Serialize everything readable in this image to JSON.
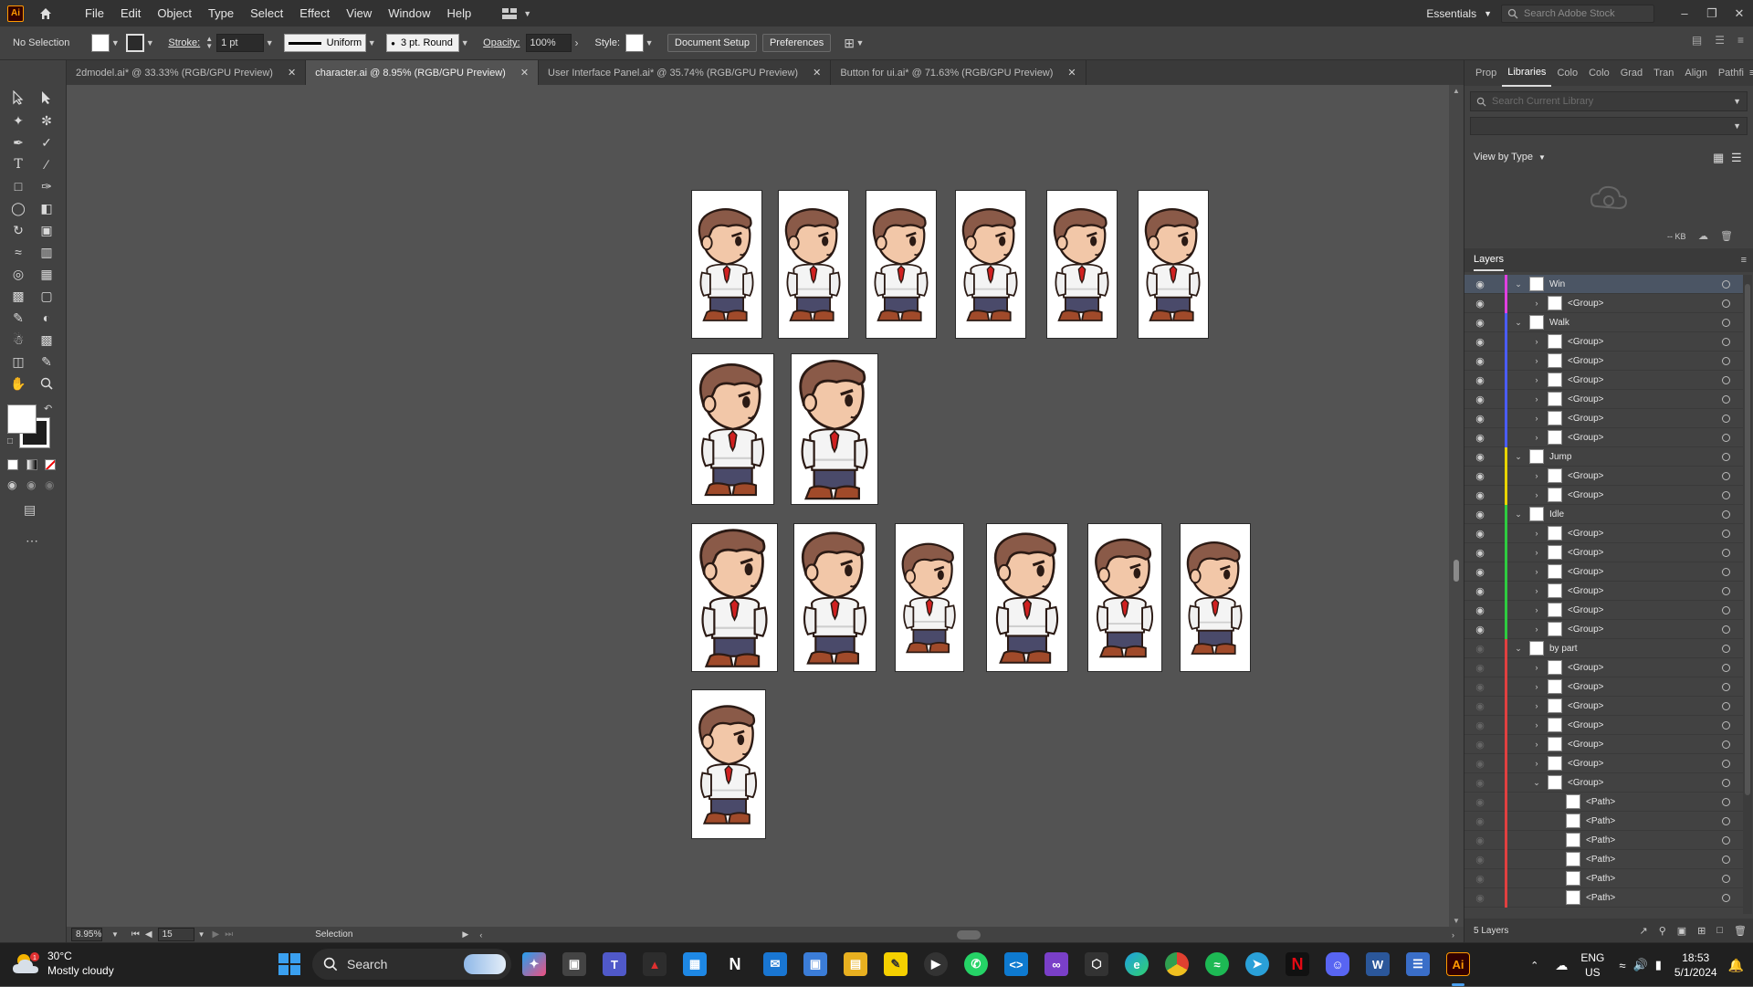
{
  "app": {
    "logo": "Ai"
  },
  "menu": [
    "File",
    "Edit",
    "Object",
    "Type",
    "Select",
    "Effect",
    "View",
    "Window",
    "Help"
  ],
  "workspace": "Essentials",
  "stock_search_placeholder": "Search Adobe Stock",
  "control_bar": {
    "selection": "No Selection",
    "stroke_label": "Stroke:",
    "stroke_weight": "1 pt",
    "stroke_profile": "Uniform",
    "brush": "3 pt. Round",
    "opacity_label": "Opacity:",
    "opacity_value": "100%",
    "style_label": "Style:",
    "document_setup": "Document Setup",
    "preferences": "Preferences"
  },
  "tabs": [
    {
      "label": "2dmodel.ai* @ 33.33% (RGB/GPU Preview)"
    },
    {
      "label": "character.ai @ 8.95% (RGB/GPU Preview)"
    },
    {
      "label": "User Interface Panel.ai* @ 35.74% (RGB/GPU Preview)"
    },
    {
      "label": "Button for ui.ai* @ 71.63% (RGB/GPU Preview)"
    }
  ],
  "status_bar": {
    "zoom": "8.95%",
    "artboard": "15",
    "tool": "Selection"
  },
  "right_panel": {
    "tabs": [
      "Prop",
      "Libraries",
      "Colo",
      "Colo",
      "Grad",
      "Tran",
      "Align",
      "Pathfi"
    ],
    "lib_search_placeholder": "Search Current Library",
    "view_by": "View by Type",
    "kb": "-- KB",
    "layers_tab": "Layers",
    "layers_count": "5 Layers",
    "rows": [
      {
        "name": "Win",
        "color": "#e040e0",
        "eye": true,
        "open": true,
        "indent": 0,
        "twisty": "v"
      },
      {
        "name": "<Group>",
        "color": "#e040e0",
        "eye": true,
        "indent": 1,
        "twisty": ">"
      },
      {
        "name": "Walk",
        "color": "#4a5cff",
        "eye": true,
        "indent": 0,
        "twisty": "v"
      },
      {
        "name": "<Group>",
        "color": "#4a5cff",
        "eye": true,
        "indent": 1,
        "twisty": ">"
      },
      {
        "name": "<Group>",
        "color": "#4a5cff",
        "eye": true,
        "indent": 1,
        "twisty": ">"
      },
      {
        "name": "<Group>",
        "color": "#4a5cff",
        "eye": true,
        "indent": 1,
        "twisty": ">"
      },
      {
        "name": "<Group>",
        "color": "#4a5cff",
        "eye": true,
        "indent": 1,
        "twisty": ">"
      },
      {
        "name": "<Group>",
        "color": "#4a5cff",
        "eye": true,
        "indent": 1,
        "twisty": ">"
      },
      {
        "name": "<Group>",
        "color": "#4a5cff",
        "eye": true,
        "indent": 1,
        "twisty": ">"
      },
      {
        "name": "Jump",
        "color": "#e8d400",
        "eye": true,
        "indent": 0,
        "twisty": "v"
      },
      {
        "name": "<Group>",
        "color": "#e8d400",
        "eye": true,
        "indent": 1,
        "twisty": ">"
      },
      {
        "name": "<Group>",
        "color": "#e8d400",
        "eye": true,
        "indent": 1,
        "twisty": ">"
      },
      {
        "name": "Idle",
        "color": "#2ecc40",
        "eye": true,
        "indent": 0,
        "twisty": "v"
      },
      {
        "name": "<Group>",
        "color": "#2ecc40",
        "eye": true,
        "indent": 1,
        "twisty": ">"
      },
      {
        "name": "<Group>",
        "color": "#2ecc40",
        "eye": true,
        "indent": 1,
        "twisty": ">"
      },
      {
        "name": "<Group>",
        "color": "#2ecc40",
        "eye": true,
        "indent": 1,
        "twisty": ">"
      },
      {
        "name": "<Group>",
        "color": "#2ecc40",
        "eye": true,
        "indent": 1,
        "twisty": ">"
      },
      {
        "name": "<Group>",
        "color": "#2ecc40",
        "eye": true,
        "indent": 1,
        "twisty": ">"
      },
      {
        "name": "<Group>",
        "color": "#2ecc40",
        "eye": true,
        "indent": 1,
        "twisty": ">"
      },
      {
        "name": "by part",
        "color": "#e04040",
        "eye": false,
        "indent": 0,
        "twisty": "v"
      },
      {
        "name": "<Group>",
        "color": "#e04040",
        "eye": false,
        "indent": 1,
        "twisty": ">"
      },
      {
        "name": "<Group>",
        "color": "#e04040",
        "eye": false,
        "indent": 1,
        "twisty": ">"
      },
      {
        "name": "<Group>",
        "color": "#e04040",
        "eye": false,
        "indent": 1,
        "twisty": ">"
      },
      {
        "name": "<Group>",
        "color": "#e04040",
        "eye": false,
        "indent": 1,
        "twisty": ">"
      },
      {
        "name": "<Group>",
        "color": "#e04040",
        "eye": false,
        "indent": 1,
        "twisty": ">"
      },
      {
        "name": "<Group>",
        "color": "#e04040",
        "eye": false,
        "indent": 1,
        "twisty": ">"
      },
      {
        "name": "<Group>",
        "color": "#e04040",
        "eye": false,
        "indent": 1,
        "twisty": "v"
      },
      {
        "name": "<Path>",
        "color": "#e04040",
        "eye": false,
        "indent": 2,
        "twisty": ""
      },
      {
        "name": "<Path>",
        "color": "#e04040",
        "eye": false,
        "indent": 2,
        "twisty": ""
      },
      {
        "name": "<Path>",
        "color": "#e04040",
        "eye": false,
        "indent": 2,
        "twisty": ""
      },
      {
        "name": "<Path>",
        "color": "#e04040",
        "eye": false,
        "indent": 2,
        "twisty": ""
      },
      {
        "name": "<Path>",
        "color": "#e04040",
        "eye": false,
        "indent": 2,
        "twisty": ""
      },
      {
        "name": "<Path>",
        "color": "#e04040",
        "eye": false,
        "indent": 2,
        "twisty": ""
      }
    ]
  },
  "taskbar": {
    "temperature": "30°C",
    "weather": "Mostly cloudy",
    "search": "Search",
    "lang_top": "ENG",
    "lang_bottom": "US",
    "time": "18:53",
    "date": "5/1/2024"
  }
}
